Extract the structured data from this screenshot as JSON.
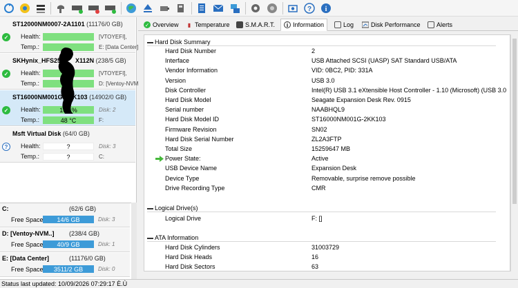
{
  "toolbar": {
    "buttons": [
      "refresh-icon",
      "scan-icon",
      "disk-list-icon",
      "acoustic-icon",
      "drive-health-icon",
      "drive-temp-icon",
      "drive-check-icon",
      "globe-icon",
      "eject-icon",
      "usb-icon",
      "removable-icon",
      "notes-icon",
      "mail-icon",
      "network-icon",
      "settings-icon",
      "speaker-icon",
      "screenshot-icon",
      "help-icon",
      "info-icon"
    ]
  },
  "disks": [
    {
      "name": "ST12000NM0007-2A1101",
      "size": "(11176/0 GB)",
      "health_label": "Health:",
      "health_value": "",
      "temp_label": "Temp.:",
      "temp_value": "",
      "side1": "[VTOYEFI],",
      "side2": "E: [Data Center]",
      "status": "ok"
    },
    {
      "name": "SKHynix_HFS256",
      "name_tail": "X112N",
      "size": "(238/5 GB)",
      "health_label": "Health:",
      "health_value": "",
      "temp_label": "Temp.:",
      "temp_value": "",
      "side1": "[VTOYEFI],",
      "side2": "D: [Ventoy-NVM",
      "status": "ok"
    },
    {
      "name": "ST16000NM001G-2KK103",
      "size": "(14902/0 GB)",
      "health_label": "Health:",
      "health_value": "100 %",
      "temp_label": "Temp.:",
      "temp_value": "48 °C",
      "side1": "Disk: 2",
      "side2": "F:",
      "status": "ok"
    },
    {
      "name": "Msft Virtual Disk",
      "size": "(64/0 GB)",
      "health_label": "Health:",
      "health_value": "?",
      "temp_label": "Temp.:",
      "temp_value": "?",
      "side1": "Disk: 3",
      "side2": "C:",
      "status": "unknown"
    }
  ],
  "volumes": [
    {
      "name": "C:",
      "size": "(62/6 GB)",
      "label": "Free Space",
      "free": "14/6 GB",
      "disk": "Disk: 3"
    },
    {
      "name": "D: [Ventoy-NVM..]",
      "size": "(238/4 GB)",
      "label": "Free Space",
      "free": "40/9 GB",
      "disk": "Disk: 1"
    },
    {
      "name": "E: [Data Center]",
      "size": "(11176/0 GB)",
      "label": "Free Space",
      "free": "3511/2 GB",
      "disk": "Disk: 0"
    }
  ],
  "tabs": [
    {
      "label": "Overview",
      "icon": "check-icon"
    },
    {
      "label": "Temperature",
      "icon": "thermometer-icon"
    },
    {
      "label": "S.M.A.R.T.",
      "icon": "smart-icon"
    },
    {
      "label": "Information",
      "icon": "info-icon"
    },
    {
      "label": "Log",
      "icon": "log-icon"
    },
    {
      "label": "Disk Performance",
      "icon": "performance-icon"
    },
    {
      "label": "Alerts",
      "icon": "alert-icon"
    }
  ],
  "info": {
    "summary_title": "Hard Disk Summary",
    "summary": [
      {
        "k": "Hard Disk Number",
        "v": "2"
      },
      {
        "k": "Interface",
        "v": "USB Attached SCSI (UASP) SAT Standard USB/ATA"
      },
      {
        "k": "Vendor Information",
        "v": "VID: 0BC2, PID: 331A"
      },
      {
        "k": "Version",
        "v": "USB 3.0"
      },
      {
        "k": "Disk Controller",
        "v": "Intel(R) USB 3.1 eXtensible Host Controller - 1.10 (Microsoft) (USB 3.0"
      },
      {
        "k": "Hard Disk Model",
        "v": "Seagate Expansion Desk  Rev. 0915"
      },
      {
        "k": "Serial number",
        "v": "NAABHQL9"
      },
      {
        "k": "Hard Disk Model ID",
        "v": "ST16000NM001G-2KK103"
      },
      {
        "k": "Firmware Revision",
        "v": "SN02"
      },
      {
        "k": "Hard Disk Serial Number",
        "v": "ZL2A3FTP"
      },
      {
        "k": "Total Size",
        "v": "15259647 MB"
      },
      {
        "k": "Power State:",
        "v": "Active"
      },
      {
        "k": "USB Device Name",
        "v": "Expansion Desk"
      },
      {
        "k": "Device Type",
        "v": "Removable, surprise remove possible"
      },
      {
        "k": "Drive Recording Type",
        "v": "CMR"
      }
    ],
    "logical_title": "Logical Drive(s)",
    "logical": [
      {
        "k": "Logical Drive",
        "v": "F: []"
      }
    ],
    "ata_title": "ATA Information",
    "ata": [
      {
        "k": "Hard Disk Cylinders",
        "v": "31003729"
      },
      {
        "k": "Hard Disk Heads",
        "v": "16"
      },
      {
        "k": "Hard Disk Sectors",
        "v": "63"
      }
    ]
  },
  "status": "Status last updated: 10/09/2026 07:29:17 È.Ù",
  "colors": {
    "accent": "#3d9bd8",
    "health_good": "#7fe07f",
    "selected_row": "#d5e9f8"
  }
}
